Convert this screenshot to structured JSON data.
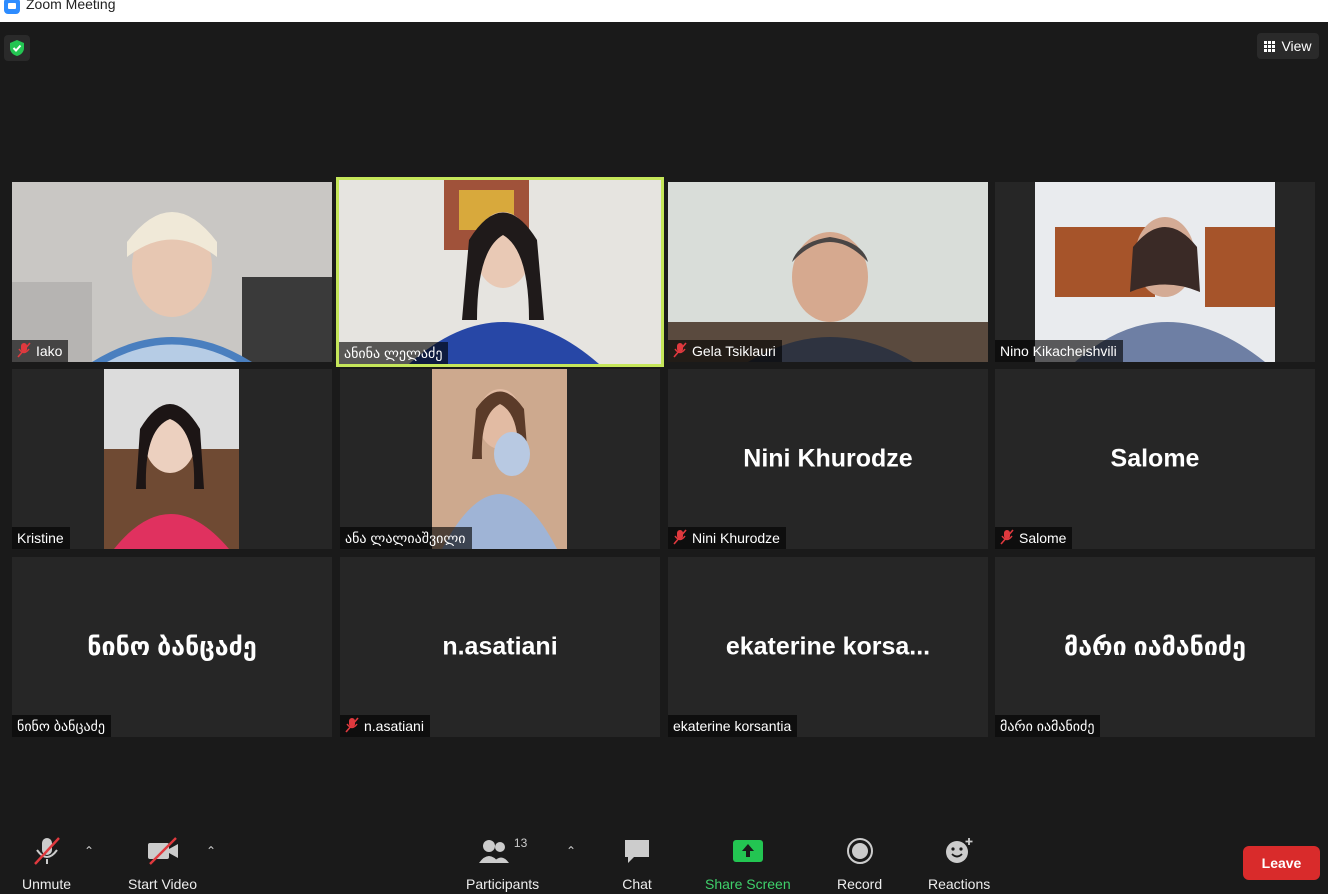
{
  "window": {
    "title": "Zoom Meeting"
  },
  "header": {
    "view_label": "View"
  },
  "participants_grid": [
    {
      "name": "Iako",
      "muted": true,
      "video": true,
      "active": false
    },
    {
      "name": "ანინა ლელაძე",
      "muted": false,
      "video": true,
      "active": true
    },
    {
      "name": "Gela Tsiklauri",
      "muted": true,
      "video": true,
      "active": false
    },
    {
      "name": "Nino Kikacheishvili",
      "muted": false,
      "video": true,
      "active": false
    },
    {
      "name": "Kristine",
      "muted": false,
      "video": true,
      "active": false
    },
    {
      "name": "ანა ლალიაშვილი",
      "muted": false,
      "video": true,
      "active": false
    },
    {
      "name": "Nini Khurodze",
      "display": "Nini Khurodze",
      "muted": true,
      "video": false,
      "active": false
    },
    {
      "name": "Salome",
      "display": "Salome",
      "muted": true,
      "video": false,
      "active": false
    },
    {
      "name": "ნინო ბანცაძე",
      "display": "ნინო ბანცაძე",
      "muted": false,
      "video": false,
      "active": false
    },
    {
      "name": "n.asatiani",
      "display": "n.asatiani",
      "muted": true,
      "video": false,
      "active": false
    },
    {
      "name": "ekaterine korsantia",
      "display": "ekaterine  korsa...",
      "muted": false,
      "video": false,
      "active": false
    },
    {
      "name": "მარი იამანიძე",
      "display": "მარი იამანიძე",
      "muted": false,
      "video": false,
      "active": false
    }
  ],
  "toolbar": {
    "unmute": "Unmute",
    "start_video": "Start Video",
    "participants": "Participants",
    "participants_count": "13",
    "chat": "Chat",
    "share_screen": "Share Screen",
    "record": "Record",
    "reactions": "Reactions",
    "leave": "Leave"
  },
  "colors": {
    "active_speaker": "#c5e65a",
    "share_green": "#3fd16b",
    "leave_red": "#d92b2b",
    "muted_red": "#e0393e"
  }
}
